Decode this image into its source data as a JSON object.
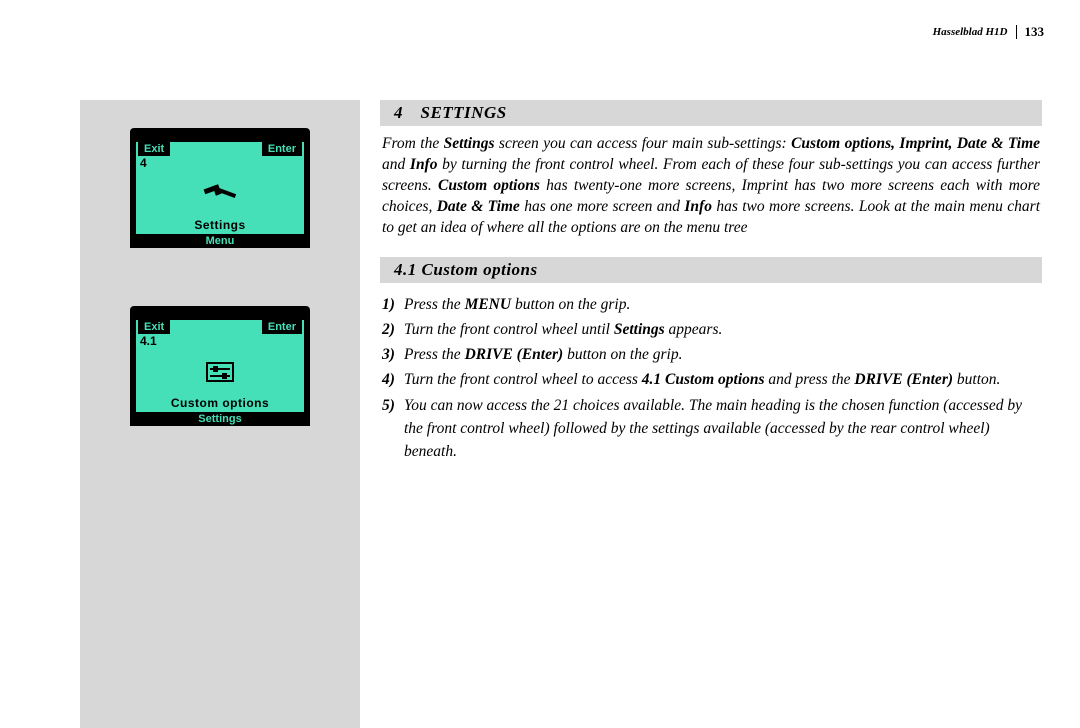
{
  "header": {
    "product": "Hasselblad H1D",
    "page": "133"
  },
  "lcd1": {
    "exit": "Exit",
    "enter": "Enter",
    "num": "4",
    "label": "Settings",
    "footer": "Menu"
  },
  "lcd2": {
    "exit": "Exit",
    "enter": "Enter",
    "num": "4.1",
    "label": "Custom options",
    "footer": "Settings"
  },
  "section4": {
    "heading": "4 SETTINGS",
    "p_a": "From the ",
    "p_b": "Settings",
    "p_c": " screen you can access four main sub-settings: ",
    "p_d": "Custom options, Imprint, Date & Time",
    "p_e": " and ",
    "p_f": "Info",
    "p_g": " by turning the front control wheel. From each of these four sub-settings you can access further screens. ",
    "p_h": "Custom options",
    "p_i": " has twenty-one more screens, Imprint has two more screens each with more choices, ",
    "p_j": "Date & Time",
    "p_k": " has one more screen and ",
    "p_l": "Info",
    "p_m": " has two more screens. Look at the main menu chart to get an idea of where all the options are on the menu tree"
  },
  "section41": {
    "heading": "4.1 Custom options",
    "items": [
      {
        "n": "1)",
        "a": "Press the ",
        "b": "MENU",
        "c": " button on the grip."
      },
      {
        "n": "2)",
        "a": "Turn the front control wheel until ",
        "b": "Settings",
        "c": " appears."
      },
      {
        "n": "3)",
        "a": "Press the ",
        "b": "DRIVE (Enter)",
        "c": " button on the grip."
      },
      {
        "n": "4)",
        "a": "Turn the front control wheel to access ",
        "b": "4.1 Custom options",
        "c": " and press the ",
        "d": "DRIVE (Enter)",
        "e": " button."
      },
      {
        "n": "5)",
        "a": "You can now access the 21 choices available. The main heading is the chosen function (accessed by the front control wheel) followed by the settings available (accessed by the rear control wheel) beneath."
      }
    ]
  }
}
